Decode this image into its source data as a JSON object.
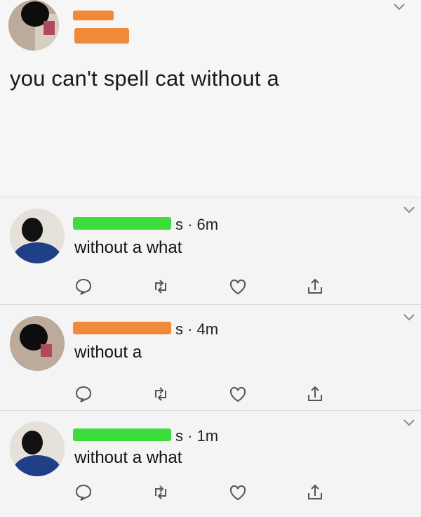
{
  "tweet": {
    "text": "you can't spell cat without a"
  },
  "replies": [
    {
      "time": "s · 6m",
      "text": "without a what"
    },
    {
      "time": "s · 4m",
      "text": "without a"
    },
    {
      "time": "s · 1m",
      "text": "without a what"
    }
  ],
  "icons": {
    "reply": "speech-bubble-icon",
    "retweet": "retweet-icon",
    "like": "heart-icon",
    "share": "share-icon",
    "menu": "chevron-down-icon"
  },
  "colors": {
    "redact_orange": "#f08a3a",
    "redact_green": "#3ddc3d"
  }
}
